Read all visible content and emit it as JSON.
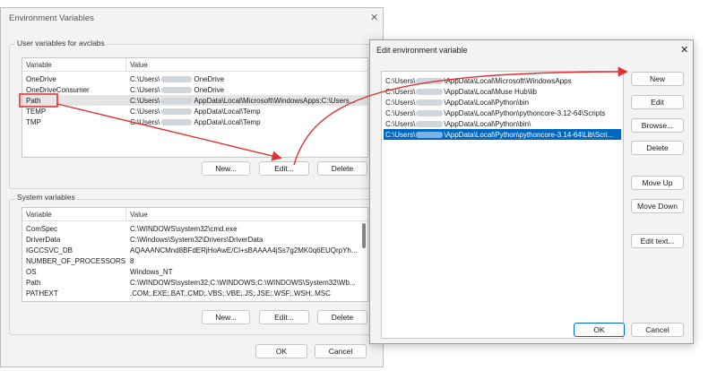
{
  "env_window": {
    "title": "Environment Variables",
    "user_group_label": "User variables for avclabs",
    "system_group_label": "System variables",
    "user_table": {
      "headers": [
        "Variable",
        "Value"
      ],
      "rows": [
        {
          "name": "OneDrive",
          "pre": "C:\\Users\\",
          "post": "OneDrive"
        },
        {
          "name": "OneDriveConsumer",
          "pre": "C:\\Users\\",
          "post": "OneDrive"
        },
        {
          "name": "Path",
          "pre": "C:\\Users\\",
          "post": "AppData\\Local\\Microsoft\\WindowsApps;C:\\Users..."
        },
        {
          "name": "TEMP",
          "pre": "C:\\Users\\",
          "post": "AppData\\Local\\Temp"
        },
        {
          "name": "TMP",
          "pre": "C:\\Users\\",
          "post": "AppData\\Local\\Temp"
        }
      ]
    },
    "system_table": {
      "headers": [
        "Variable",
        "Value"
      ],
      "rows": [
        {
          "name": "ComSpec",
          "value": "C:\\WINDOWS\\system32\\cmd.exe"
        },
        {
          "name": "DriverData",
          "value": "C:\\Windows\\System32\\Drivers\\DriverData"
        },
        {
          "name": "IGCCSVC_DB",
          "value": "AQAAANCMnd8BFdERjHoAwE/Cl+sBAAAA4jSs7g2MK0q6EUQrpYh..."
        },
        {
          "name": "NUMBER_OF_PROCESSORS",
          "value": "8"
        },
        {
          "name": "OS",
          "value": "Windows_NT"
        },
        {
          "name": "Path",
          "value": "C:\\WINDOWS\\system32;C:\\WINDOWS;C:\\WINDOWS\\System32\\Wb..."
        },
        {
          "name": "PATHEXT",
          "value": ".COM;.EXE;.BAT;.CMD;.VBS;.VBE;.JS;.JSE;.WSF;.WSH;.MSC"
        }
      ]
    },
    "buttons": {
      "new": "New...",
      "edit": "Edit...",
      "delete": "Delete",
      "ok": "OK",
      "cancel": "Cancel"
    }
  },
  "edit_dialog": {
    "title": "Edit environment variable",
    "entries": [
      {
        "pre": "C:\\Users\\",
        "post": "\\AppData\\Local\\Microsoft\\WindowsApps"
      },
      {
        "pre": "C:\\Users\\",
        "post": "\\AppData\\Local\\Muse Hub\\lib"
      },
      {
        "pre": "C:\\Users\\",
        "post": "\\AppData\\Local\\Python\\bin"
      },
      {
        "pre": "C:\\Users\\",
        "post": "\\AppData\\Local\\Python\\pythoncore-3.12-64\\Scripts"
      },
      {
        "pre": "C:\\Users\\",
        "post": "\\AppData\\Local\\Python\\bin\\"
      },
      {
        "pre": "C:\\Users\\",
        "post": "\\AppData\\Local\\Python\\pythoncore-3.14-64\\Lib\\Scri..."
      }
    ],
    "buttons": {
      "new": "New",
      "edit": "Edit",
      "browse": "Browse...",
      "delete": "Delete",
      "move_up": "Move Up",
      "move_down": "Move Down",
      "edit_text": "Edit text...",
      "ok": "OK",
      "cancel": "Cancel"
    }
  },
  "icons": {
    "close": "✕"
  },
  "colors": {
    "selection": "#0067c0",
    "annotation": "#e03030"
  }
}
